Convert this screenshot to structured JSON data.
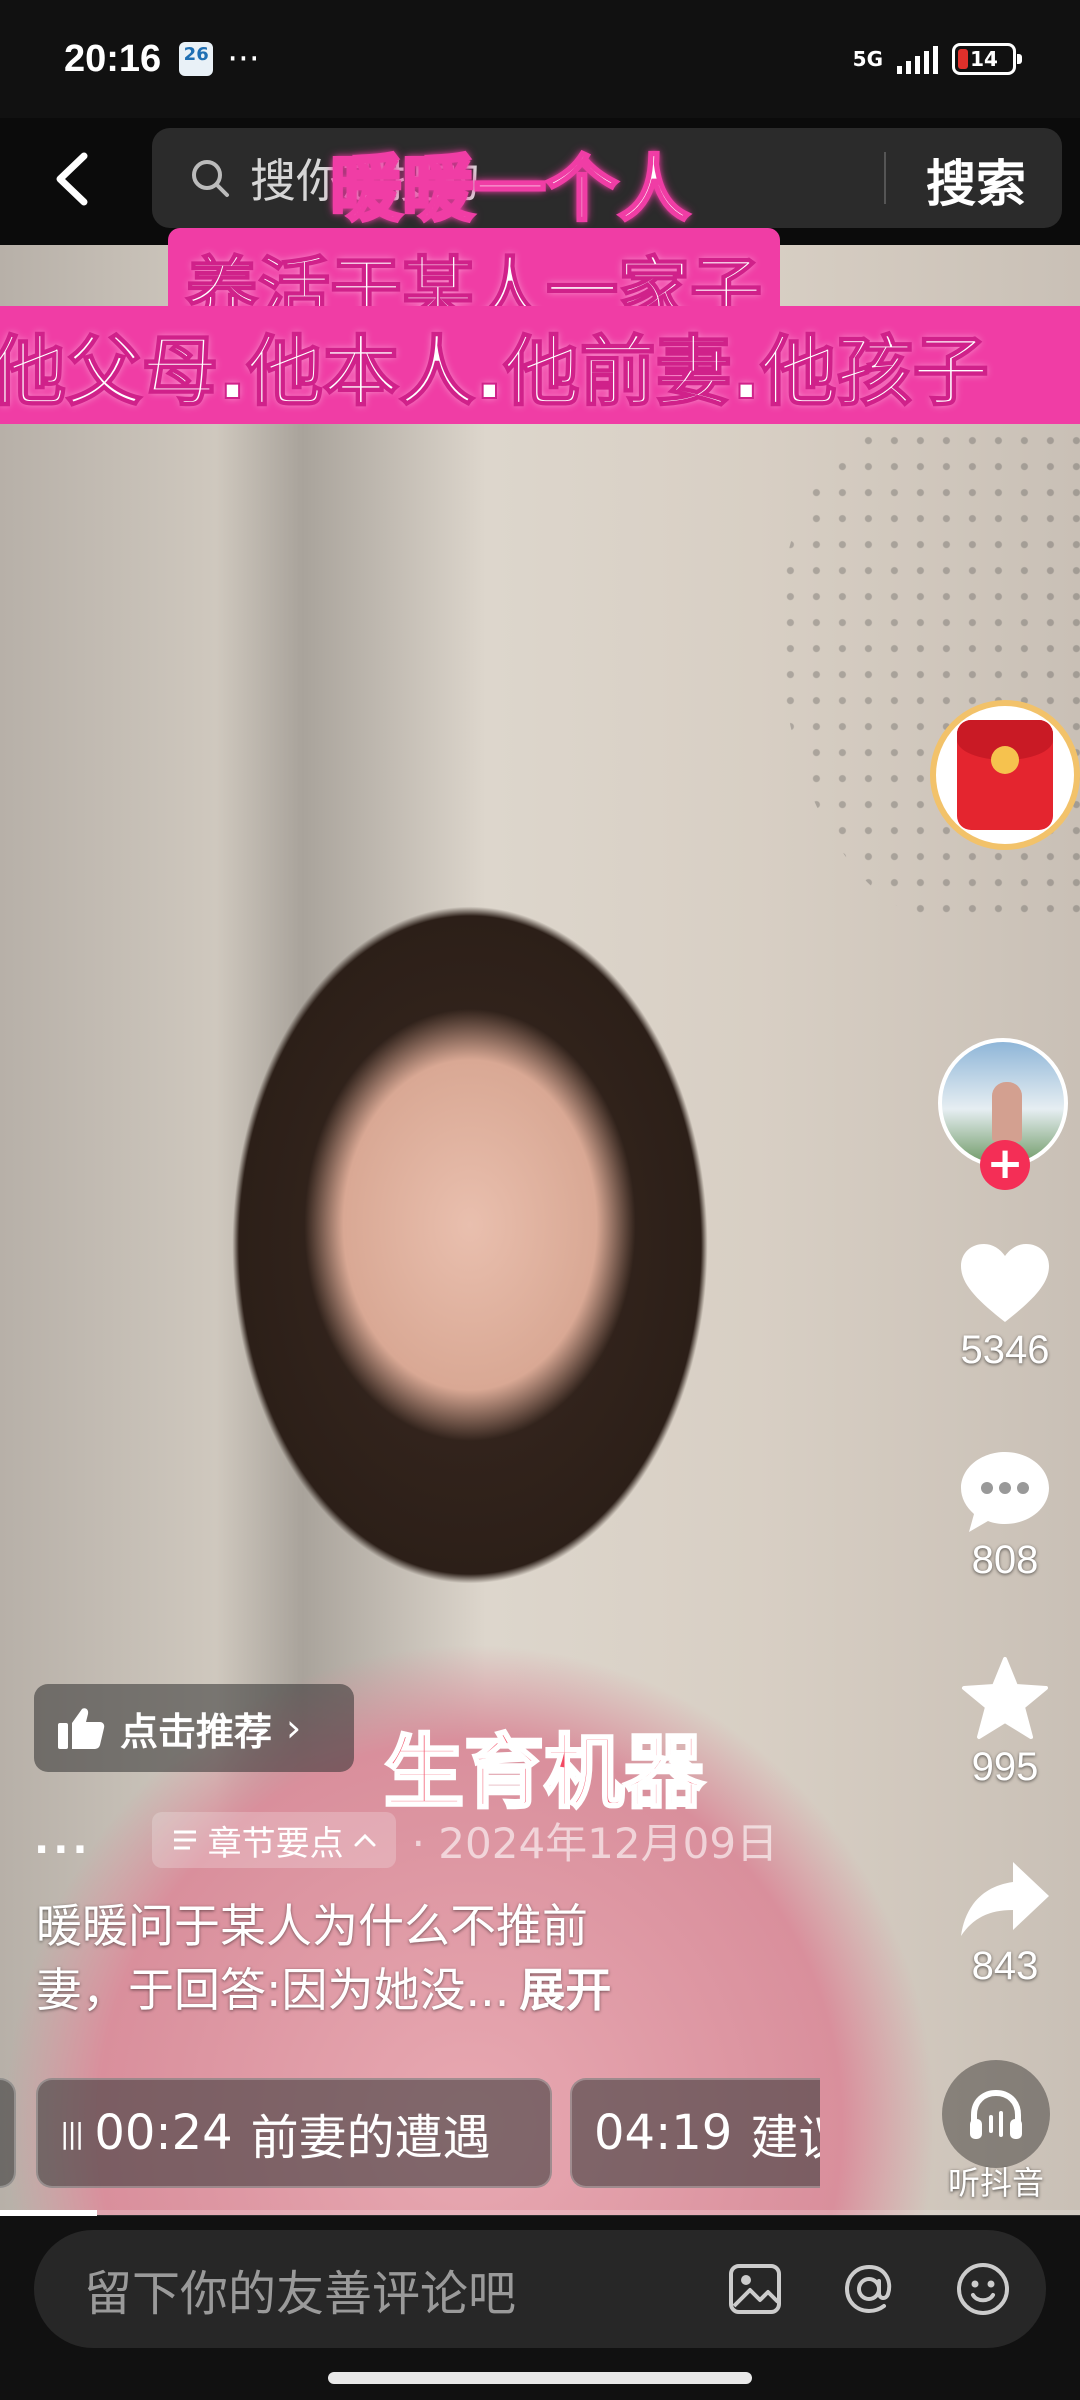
{
  "status_bar": {
    "time": "20:16",
    "calendar_day": "26",
    "more": "···",
    "network": "5G",
    "battery": "14"
  },
  "search": {
    "placeholder": "搜你想搜的",
    "button": "搜索"
  },
  "video_overlay": {
    "line1": "暖暖一个人",
    "line2": "养活于某人一家子",
    "line3": "他父母.他本人.他前妻.他孩子",
    "caption": "生育机器"
  },
  "actions": {
    "likes": "5346",
    "comments": "808",
    "favorites": "995",
    "shares": "843",
    "listen_label": "听抖音"
  },
  "recommend": {
    "label": "点击推荐"
  },
  "meta": {
    "dots": "...",
    "chapter_chip": "章节要点",
    "date": "· 2024年12月09日"
  },
  "description": {
    "line1": "暖暖问于某人为什么不推前",
    "line2": "妻，于回答:因为她没...",
    "expand": "展开"
  },
  "chapters": [
    {
      "time": "00:24",
      "title": "前妻的遭遇"
    },
    {
      "time": "04:19",
      "title": "建议"
    }
  ],
  "progress_fraction": 0.09,
  "comment_bar": {
    "placeholder": "留下你的友善评论吧"
  },
  "colors": {
    "sticker_pink": "#f03da5",
    "like_red": "#f42e56",
    "caption_red": "#f24a63"
  }
}
